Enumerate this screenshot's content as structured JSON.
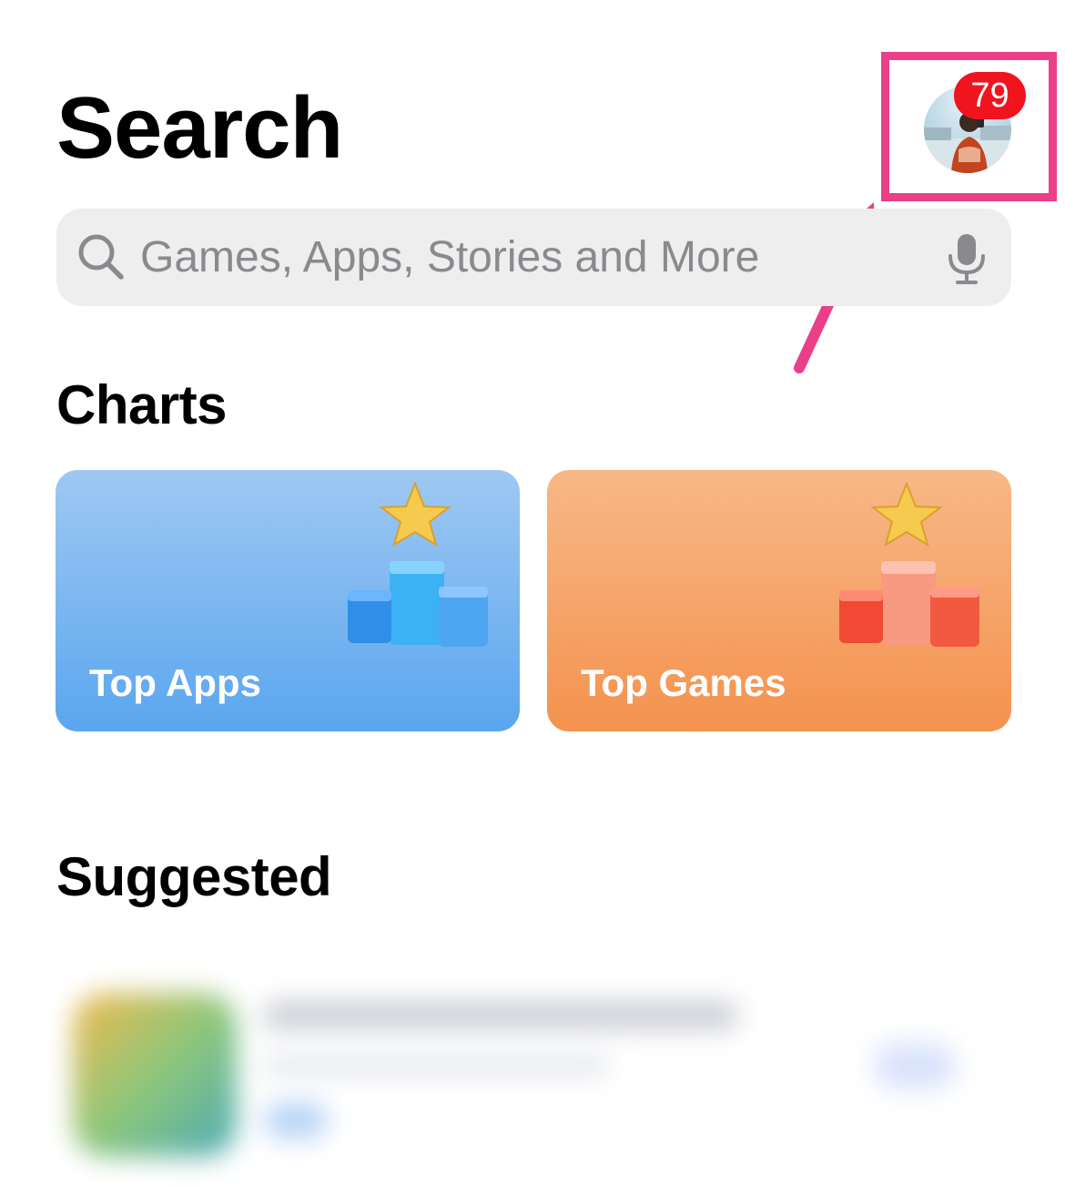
{
  "header": {
    "title": "Search",
    "profile": {
      "avatar_icon": "profile-photo-avatar",
      "badge_count": "79",
      "badge_color": "#f0141e",
      "highlight_color": "#ec3f8a"
    }
  },
  "search": {
    "placeholder": "Games, Apps, Stories and More",
    "value": "",
    "left_icon": "search-icon",
    "right_icon": "microphone-icon"
  },
  "charts": {
    "heading": "Charts",
    "cards": [
      {
        "label": "Top Apps",
        "icon": "podium-star-icon",
        "color": "#5aa6ef"
      },
      {
        "label": "Top Games",
        "icon": "podium-star-icon",
        "color": "#f4924e"
      }
    ]
  },
  "suggested": {
    "heading": "Suggested"
  }
}
